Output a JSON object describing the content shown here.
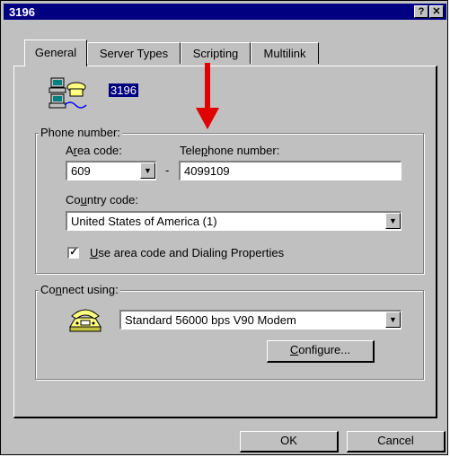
{
  "window": {
    "title": "3196",
    "help_button": "?",
    "close_button": "X"
  },
  "tabs": [
    {
      "label": "General",
      "active": true
    },
    {
      "label": "Server Types",
      "active": false
    },
    {
      "label": "Scripting",
      "active": false
    },
    {
      "label": "Multilink",
      "active": false
    }
  ],
  "connection": {
    "name": "3196",
    "icon": "dial-up-computer-icon"
  },
  "phone_number": {
    "group_label": "Phone number:",
    "area_code_label_pre": "A",
    "area_code_label_mn": "r",
    "area_code_label_post": "ea code:",
    "area_code_value": "609",
    "separator": "-",
    "telephone_label_pre": "Tele",
    "telephone_label_mn": "p",
    "telephone_label_post": "hone number:",
    "telephone_value": "4099109",
    "country_label_pre": "Co",
    "country_label_mn": "u",
    "country_label_post": "ntry code:",
    "country_value": "United States of America (1)",
    "use_area_code_checked": true,
    "use_area_code_label_mn": "U",
    "use_area_code_label_post": "se area code and Dialing Properties"
  },
  "connect_using": {
    "group_label_pre": "Co",
    "group_label_mn": "n",
    "group_label_post": "nect using:",
    "modem_value": "Standard 56000 bps V90 Modem",
    "modem_icon": "telephone-modem-icon",
    "configure_label_mn": "C",
    "configure_label_post": "onfigure..."
  },
  "footer": {
    "ok_label": "OK",
    "cancel_label": "Cancel"
  },
  "annotation": {
    "arrow_color": "#e00000"
  },
  "colors": {
    "title_bar": "#000080",
    "face": "#c0c0c0"
  }
}
